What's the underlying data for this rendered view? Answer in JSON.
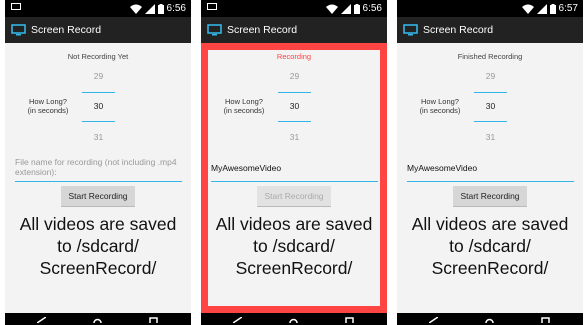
{
  "phones": [
    {
      "status_bar": {
        "time": "6:56"
      },
      "app_title": "Screen Record",
      "recording_status": "Not Recording Yet",
      "picker": {
        "prev": "29",
        "current": "30",
        "next": "31",
        "label_line1": "How Long?",
        "label_line2": "(in seconds)"
      },
      "filename": {
        "placeholder": "File name for recording (not including .mp4 extension):",
        "value": ""
      },
      "button_label": "Start Recording",
      "info_line1": "All videos are saved",
      "info_line2": "to /sdcard/",
      "info_line3": "ScreenRecord/"
    },
    {
      "status_bar": {
        "time": "6:56"
      },
      "app_title": "Screen Record",
      "recording_status": "Recording",
      "picker": {
        "prev": "29",
        "current": "30",
        "next": "31",
        "label_line1": "How Long?",
        "label_line2": "(in seconds)"
      },
      "filename": {
        "placeholder": "",
        "value": "MyAwesomeVideo"
      },
      "button_label": "Start Recording",
      "info_line1": "All videos are saved",
      "info_line2": "to /sdcard/",
      "info_line3": "ScreenRecord/"
    },
    {
      "status_bar": {
        "time": "6:57"
      },
      "app_title": "Screen Record",
      "recording_status": "Finished Recording",
      "picker": {
        "prev": "29",
        "current": "30",
        "next": "31",
        "label_line1": "How Long?",
        "label_line2": "(in seconds)"
      },
      "filename": {
        "placeholder": "",
        "value": "MyAwesomeVideo"
      },
      "button_label": "Start Recording",
      "info_line1": "All videos are saved",
      "info_line2": "to /sdcard/",
      "info_line3": "ScreenRecord/"
    }
  ],
  "colors": {
    "accent_line": "#33b5e5",
    "recording_status": "#ff4444",
    "highlight_border": "#ff4444",
    "action_bar": "#222222"
  }
}
